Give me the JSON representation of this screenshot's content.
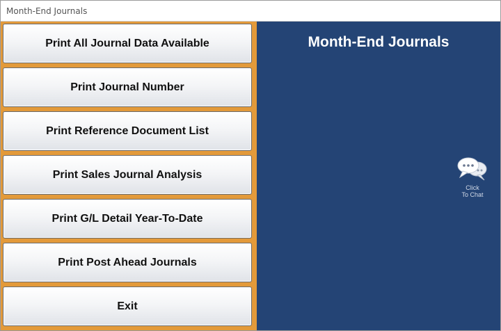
{
  "window": {
    "title": "Month-End Journals"
  },
  "menu": {
    "buttons": [
      {
        "label": "Print All Journal Data Available"
      },
      {
        "label": "Print Journal Number"
      },
      {
        "label": "Print Reference Document List"
      },
      {
        "label": "Print Sales Journal Analysis"
      },
      {
        "label": "Print G/L Detail Year-To-Date"
      },
      {
        "label": "Print Post Ahead Journals"
      },
      {
        "label": "Exit"
      }
    ]
  },
  "info_panel": {
    "heading": "Month-End Journals"
  },
  "chat": {
    "icon": "chat-bubbles-icon",
    "line1": "Click",
    "line2": "To Chat"
  },
  "colors": {
    "left_panel_bg": "#e39a3a",
    "right_panel_bg": "#244475",
    "button_text": "#111111",
    "heading_text": "#ffffff"
  }
}
